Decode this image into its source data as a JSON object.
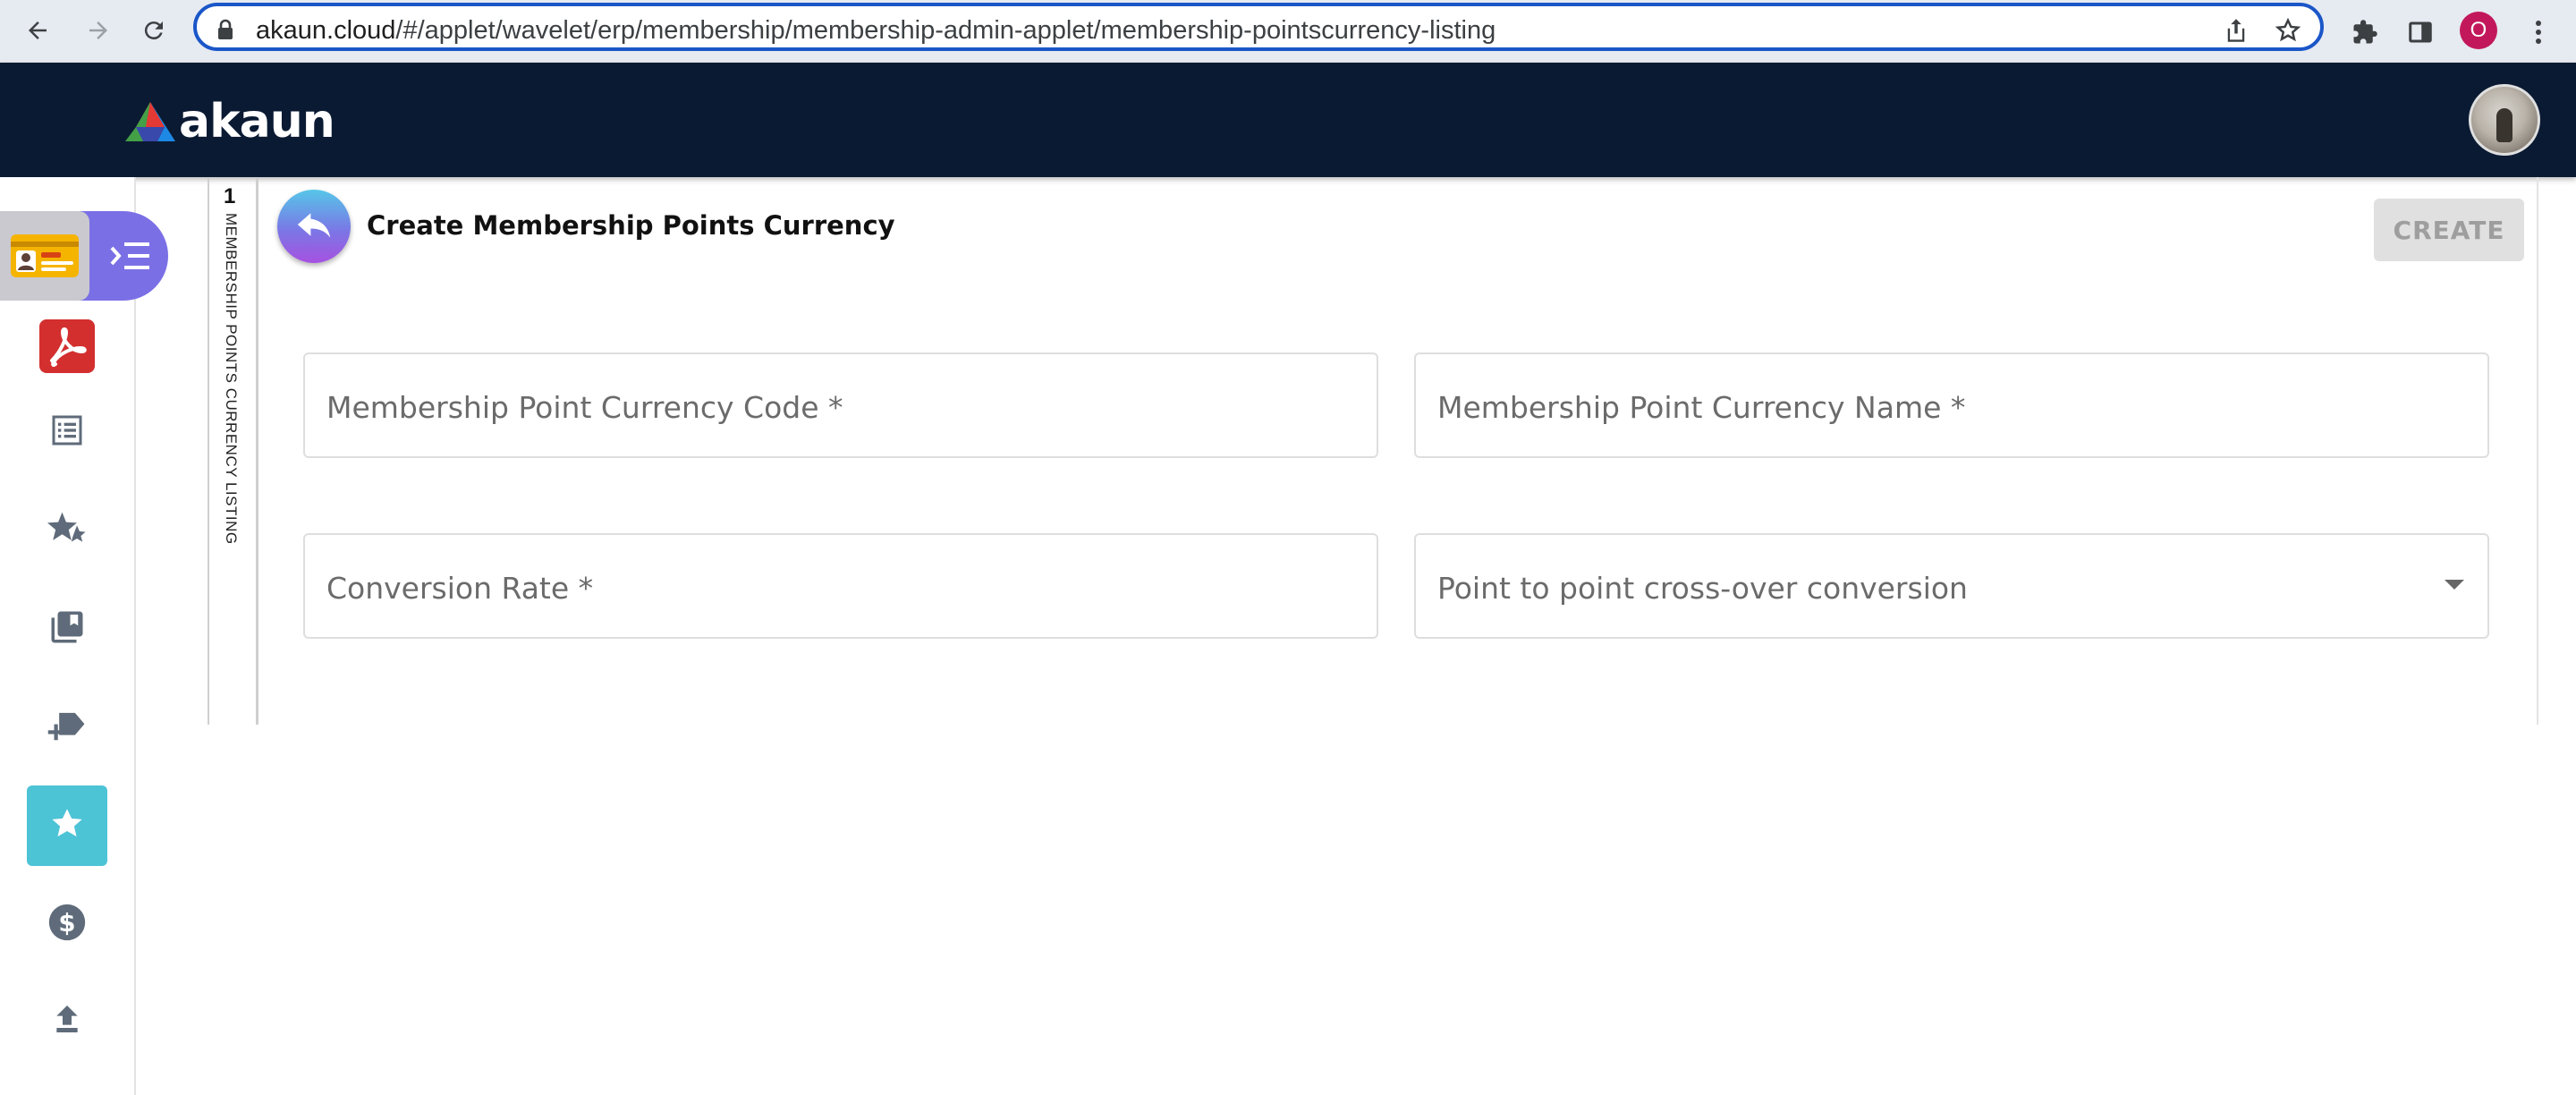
{
  "browser": {
    "url_host": "akaun.cloud",
    "url_path": "/#/applet/wavelet/erp/membership/membership-admin-applet/membership-pointscurrency-listing",
    "profile_initial": "O"
  },
  "header": {
    "logo_text": "akaun"
  },
  "sidebar": {
    "items": [
      {
        "icon": "adobe-acrobat-icon"
      },
      {
        "icon": "list-icon"
      },
      {
        "icon": "stars-icon"
      },
      {
        "icon": "library-books-icon"
      },
      {
        "icon": "add-label-icon"
      },
      {
        "icon": "star-icon",
        "active": true
      },
      {
        "icon": "dollar-icon"
      },
      {
        "icon": "upload-icon"
      }
    ]
  },
  "page": {
    "tab_number": "1",
    "tab_label": "MEMBERSHIP POINTS CURRENCY LISTING",
    "title": "Create Membership Points Currency",
    "create_label": "CREATE"
  },
  "form": {
    "currency_code_placeholder": "Membership Point Currency Code *",
    "currency_name_placeholder": "Membership Point Currency Name *",
    "conversion_rate_placeholder": "Conversion Rate *",
    "crossover_placeholder": "Point to point cross-over conversion"
  },
  "colors": {
    "header_bg": "#0a1a33",
    "applet_tab": "#7b6fe6",
    "active_item": "#4dc3d6",
    "acrobat_red": "#d32f2f"
  }
}
